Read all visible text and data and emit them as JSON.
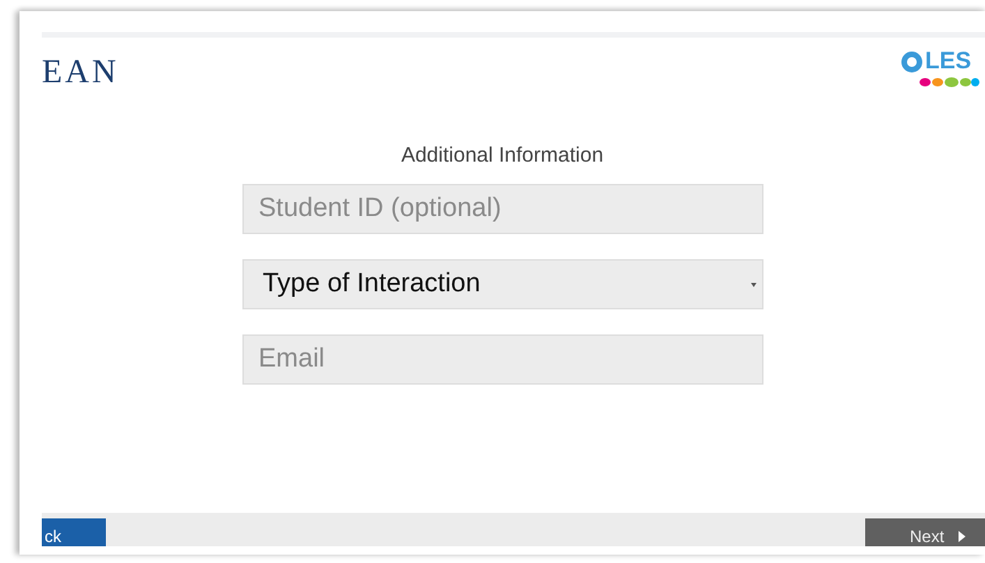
{
  "header": {
    "left_logo": "EAN",
    "right_logo": "LES"
  },
  "title": "Additional Information",
  "fields": [
    {
      "kind": "input",
      "placeholder": "Student ID (optional)"
    },
    {
      "kind": "select",
      "value": "Type of Interaction"
    },
    {
      "kind": "input",
      "placeholder": "Email"
    }
  ],
  "footer": {
    "back": "ck",
    "next": "Next"
  }
}
